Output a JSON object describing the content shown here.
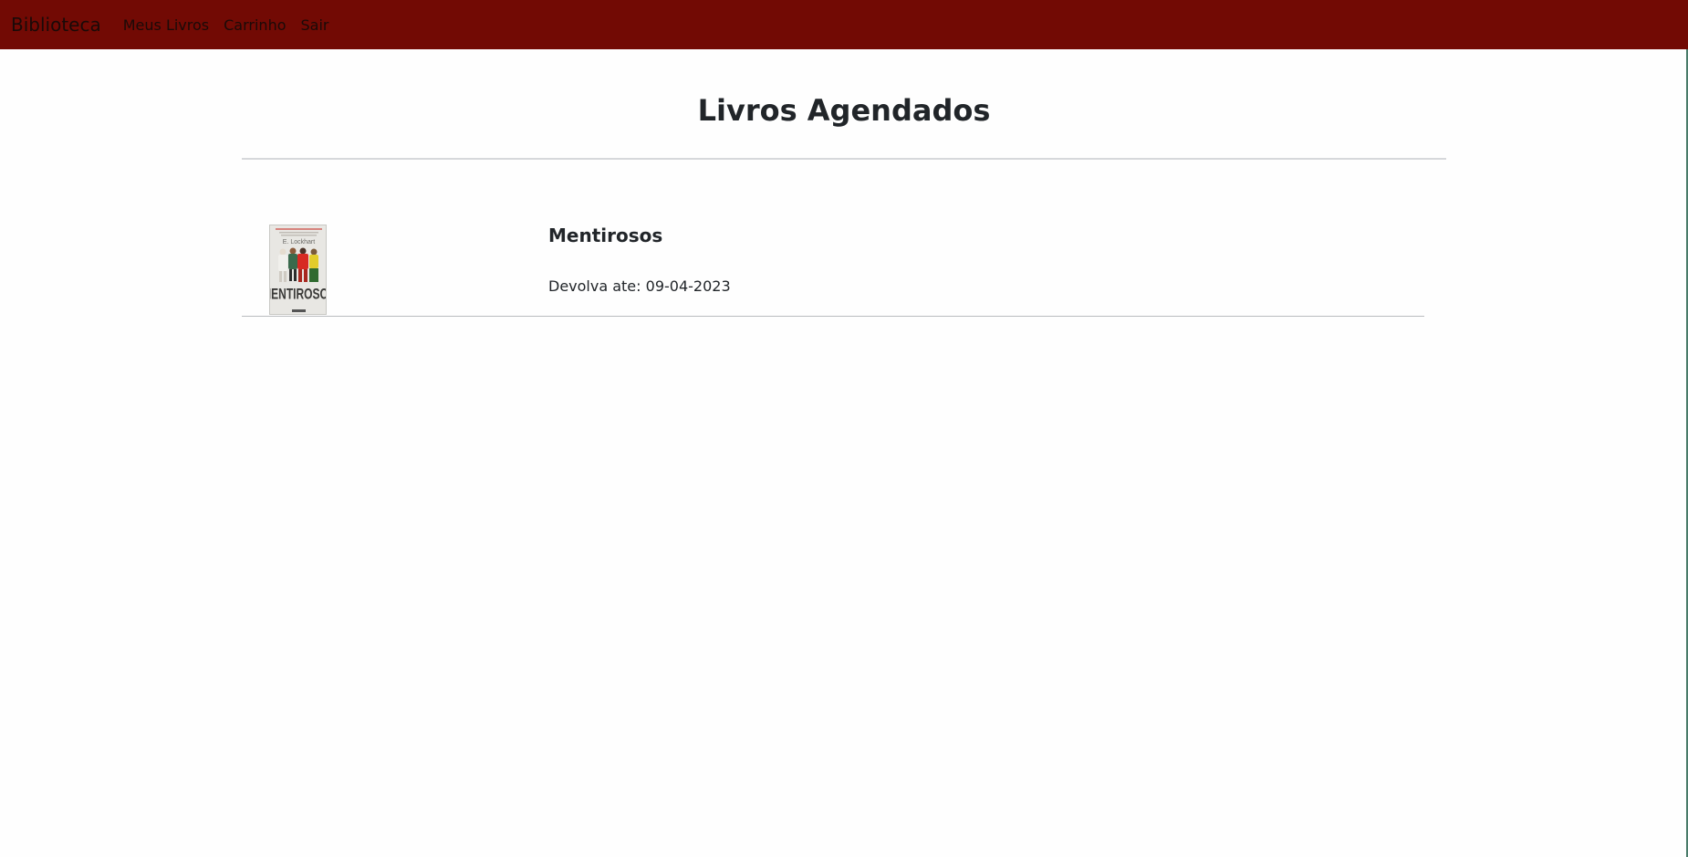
{
  "navbar": {
    "brand": "Biblioteca",
    "links": [
      "Meus Livros",
      "Carrinho",
      "Sair"
    ],
    "background_color": "#720a04"
  },
  "main": {
    "title": "Livros Agendados",
    "books": [
      {
        "title": "Mentirosos",
        "due_label": "Devolva ate:",
        "due_date": "09-04-2023",
        "cover": {
          "author": "E. Lockhart",
          "title": "MENTIROSOS"
        }
      }
    ]
  }
}
